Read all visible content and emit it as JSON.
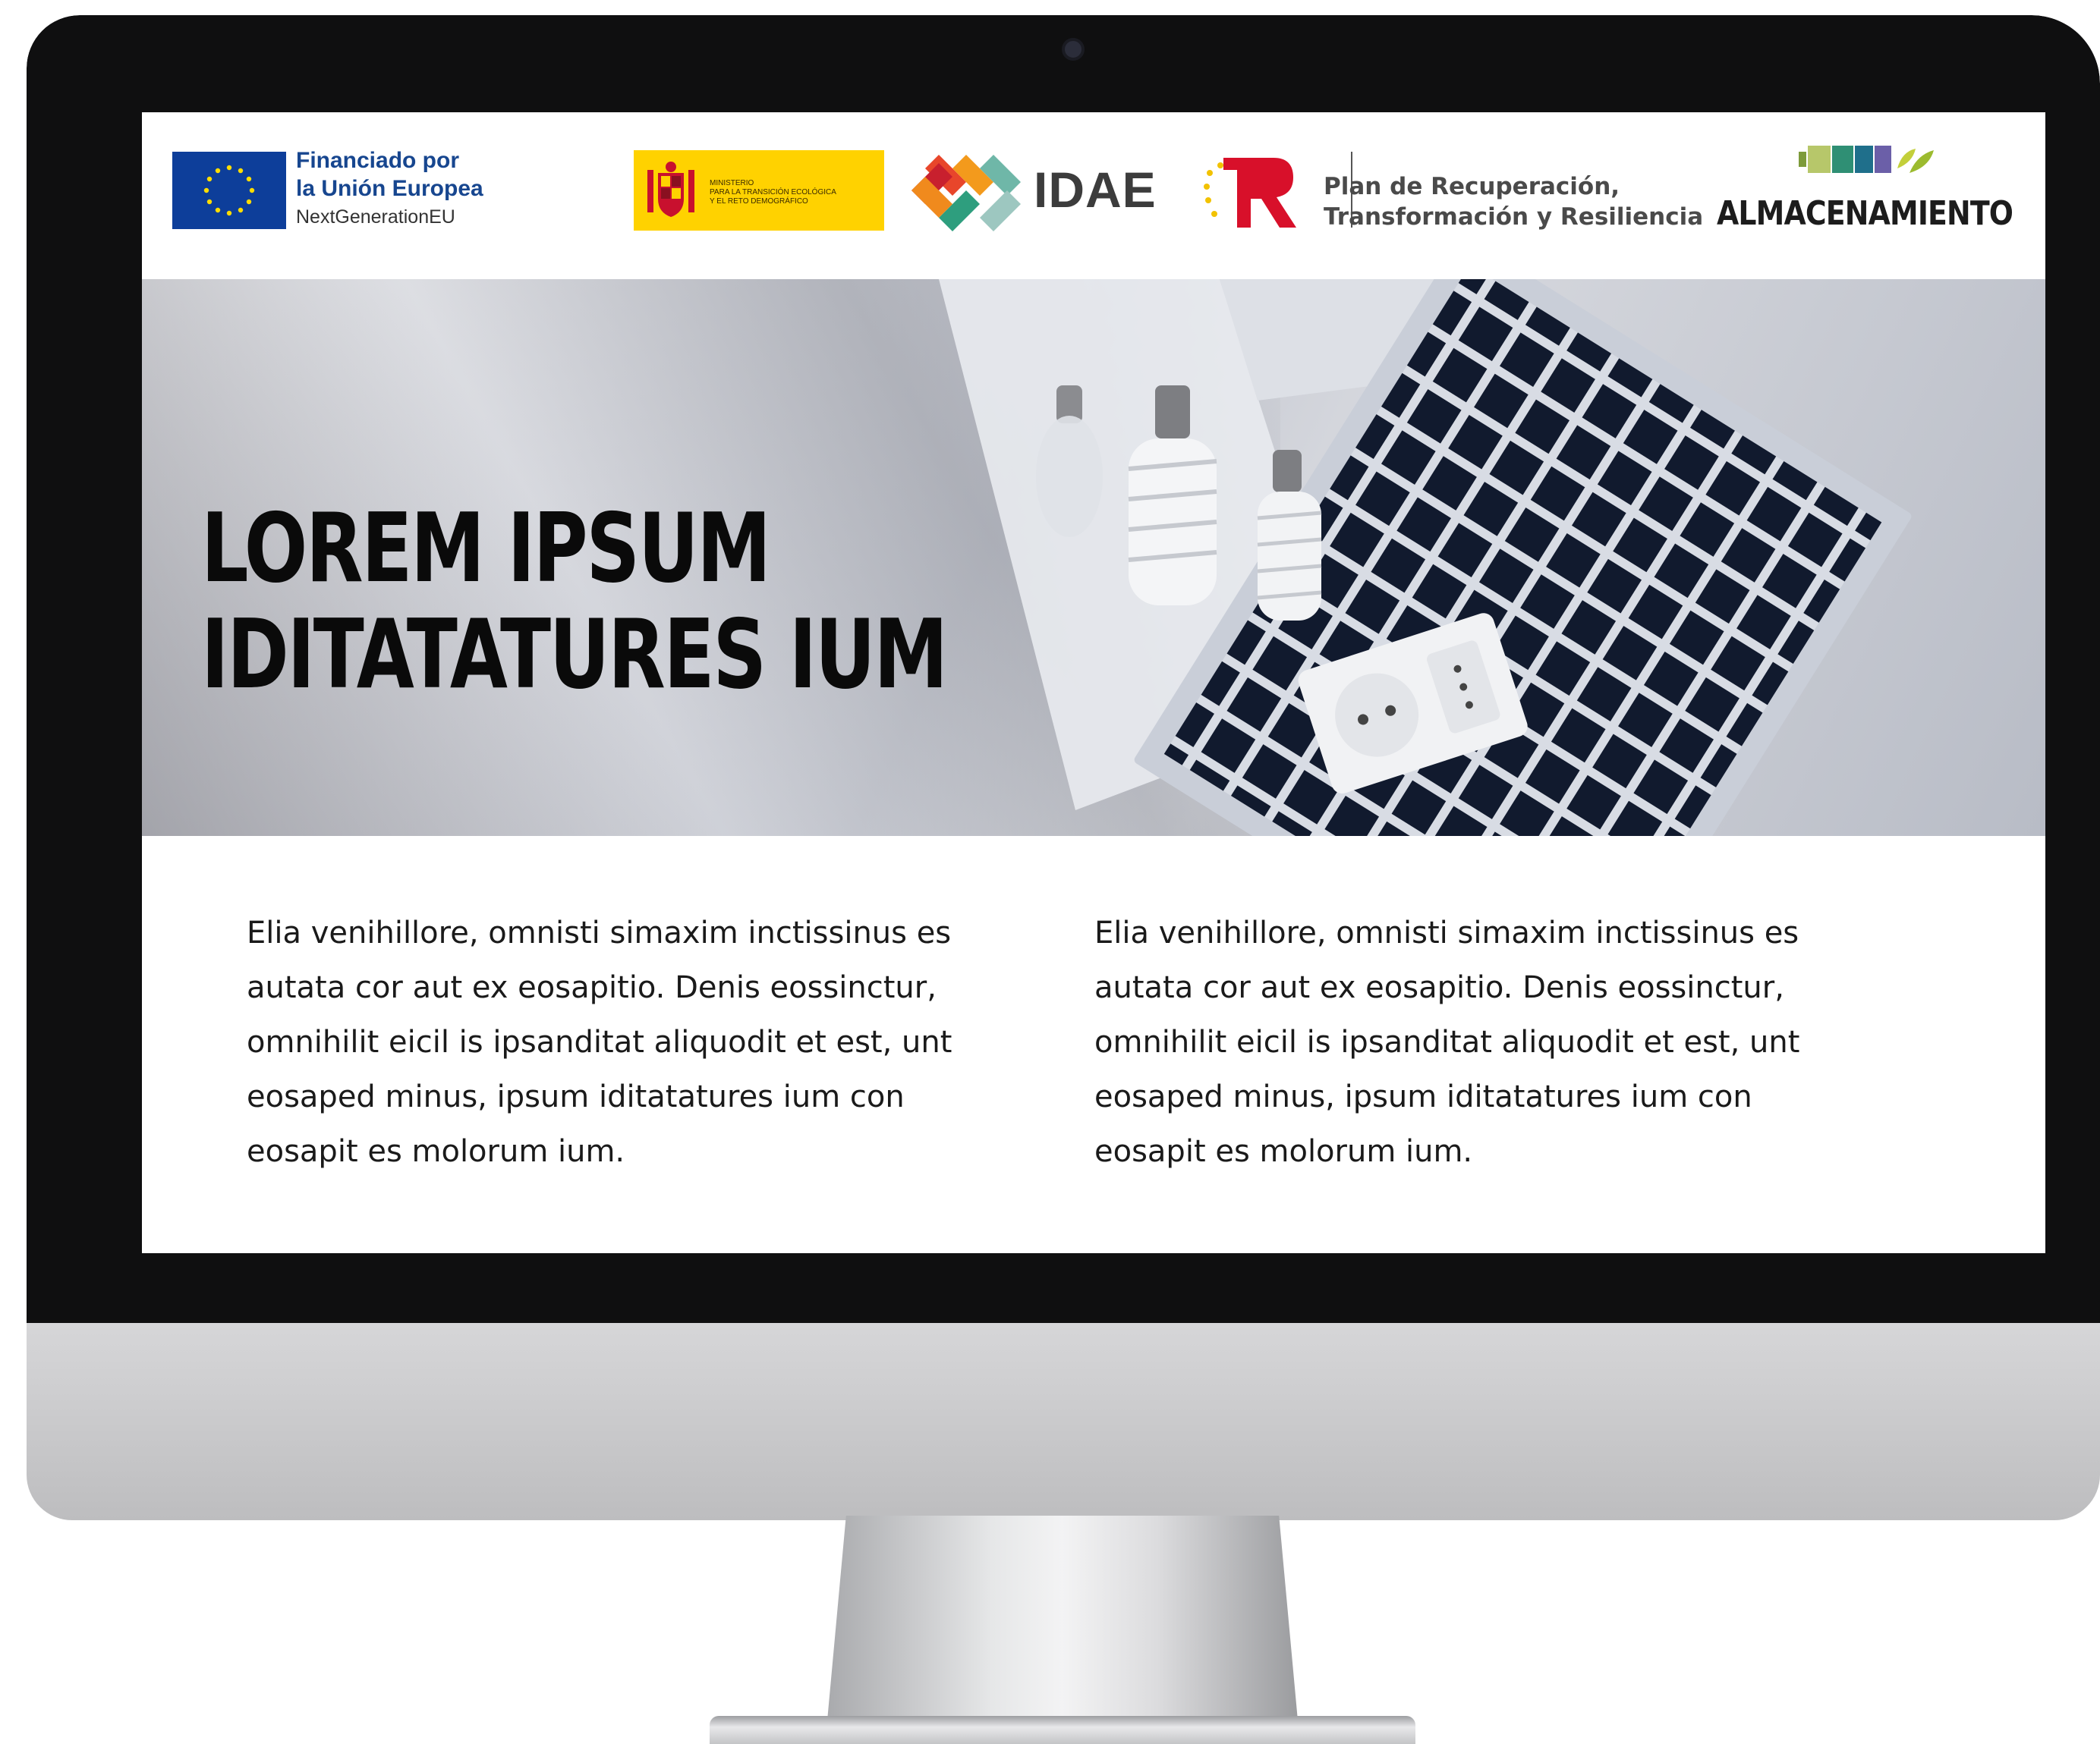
{
  "logos": {
    "eu": {
      "line1": "Financiado por",
      "line2": "la Unión Europea",
      "line3": "NextGenerationEU",
      "flag_color": "#0d3e9a"
    },
    "ministerio": {
      "line1": "MINISTERIO",
      "line2": "PARA LA TRANSICIÓN ECOLÓGICA",
      "line3": "Y EL RETO DEMOGRÁFICO",
      "color": "#ffd200"
    },
    "idae": {
      "label": "IDAE"
    },
    "prtr": {
      "line1": "Plan de Recuperación,",
      "line2": "Transformación y Resiliencia",
      "accent": "#d8102a"
    },
    "almacenamiento": {
      "label": "ALMACENAMIENTO"
    }
  },
  "hero": {
    "title_line1": "LOREM IPSUM",
    "title_line2": "IDITATATURES IUM"
  },
  "content": {
    "left_paragraph": "Elia venihillore, omnisti simaxim inctissinus es autata cor aut ex eosapitio. Denis eossinctur, omnihilit eicil is ipsanditat aliquodit et est, unt eosaped minus, ipsum iditatatures ium con eosapit es molorum ium.",
    "right_paragraph": "Elia venihillore, omnisti simaxim inctissinus es autata cor aut ex eosapitio. Denis eossinctur, omnihilit eicil is ipsanditat aliquodit et est, unt eosaped minus, ipsum iditatatures ium con eosapit es molorum ium."
  }
}
